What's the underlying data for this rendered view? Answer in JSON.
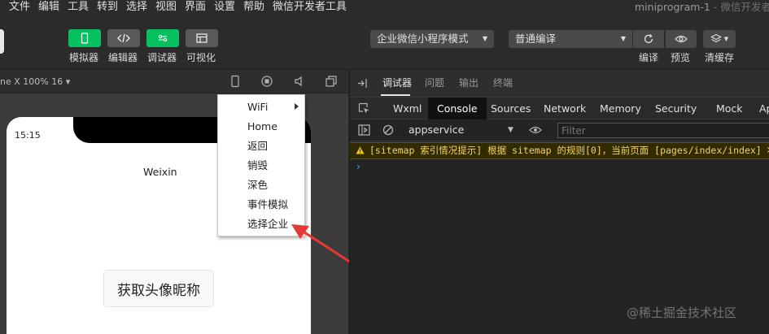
{
  "menubar": {
    "items": [
      "文件",
      "编辑",
      "工具",
      "转到",
      "选择",
      "视图",
      "界面",
      "设置",
      "帮助",
      "微信开发者工具"
    ],
    "window_title": "miniprogram-1",
    "window_title_suffix": " - 微信开发者"
  },
  "toolbar": {
    "simulator_label": "模拟器",
    "editor_label": "编辑器",
    "debugger_label": "调试器",
    "visual_label": "可视化",
    "mode_select": "企业微信小程序模式",
    "compile_select": "普通编译",
    "compile_label": "编译",
    "preview_label": "预览",
    "clear_cache_label": "清缓存",
    "accent_color": "#07c160"
  },
  "simulator": {
    "device_label": "ne X 100% 16 ▾",
    "status_time": "15:15",
    "page_title": "Weixin",
    "avatar_button": "获取头像昵称"
  },
  "context_menu": {
    "items": [
      "WiFi",
      "Home",
      "返回",
      "销毁",
      "深色",
      "事件模拟",
      "选择企业"
    ]
  },
  "devtools": {
    "top_tabs": [
      "调试器",
      "问题",
      "输出",
      "终端"
    ],
    "panel_tabs": [
      "Wxml",
      "Console",
      "Sources",
      "Network",
      "Memory",
      "Security",
      "Mock",
      "Ap"
    ],
    "context": "appservice",
    "filter_placeholder": "Filter",
    "warning": "[sitemap 索引情况提示] 根据 sitemap 的规则[0]，当前页面 [pages/index/index] 将",
    "prompt": "›"
  },
  "watermark": "@稀土掘金技术社区"
}
